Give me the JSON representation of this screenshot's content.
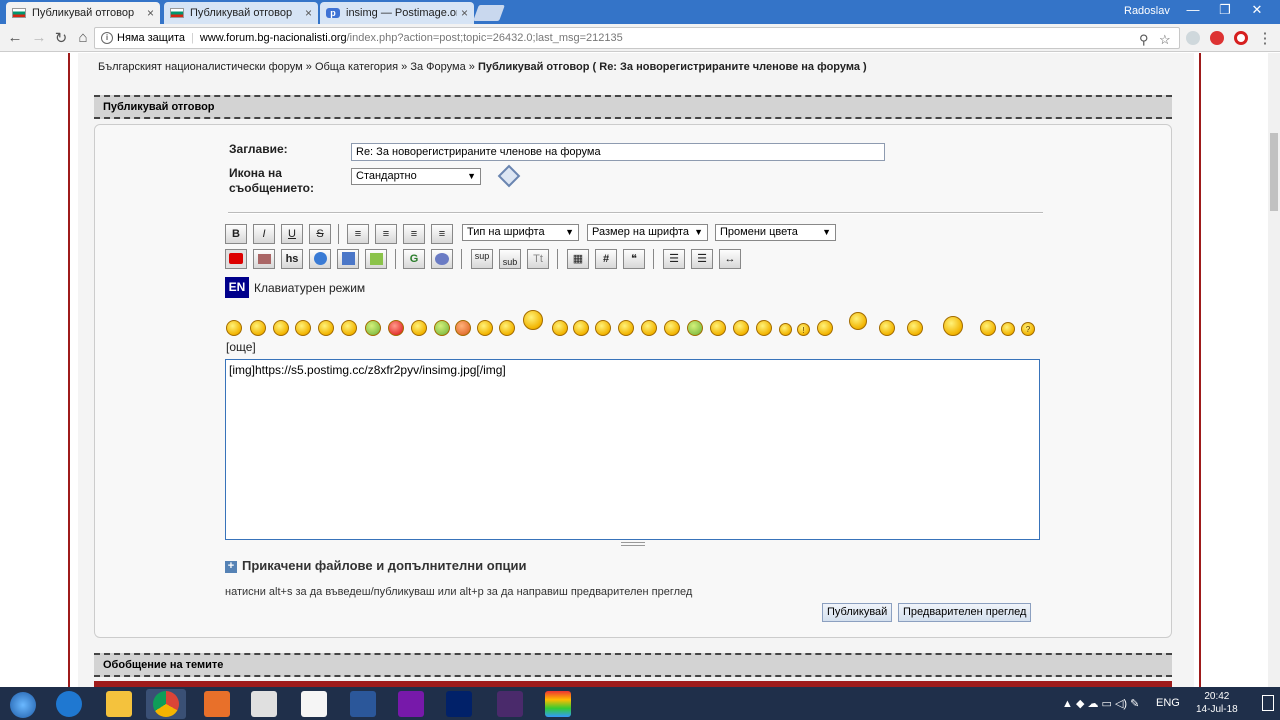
{
  "browser": {
    "tabs": [
      {
        "label": "Публикувай отговор",
        "icon": "bulgarian-flag-icon",
        "active": true
      },
      {
        "label": "Публикувай отговор",
        "icon": "bulgarian-flag-icon",
        "active": false
      },
      {
        "label": "insimg — Postimage.org",
        "icon": "postimage-icon",
        "active": false
      }
    ],
    "close_glyph": "×",
    "user": "Radoslav",
    "window_controls": {
      "minimize": "—",
      "maximize": "❐",
      "close": "✕"
    },
    "security_label": "Няма защита",
    "url_host": "www.forum.bg-nacionalisti.org",
    "url_path": "/index.php?action=post;topic=26432.0;last_msg=212135"
  },
  "forum": {
    "breadcrumb": {
      "c1": "Българският националистически форум",
      "sep": "»",
      "c2": "Обща категория",
      "c3": "За Форума",
      "c4": "Публикувай отговор",
      "topic": "( Re: За новорегистрираните членове на форума )"
    },
    "header": "Публикувай отговор",
    "subject_label": "Заглавие:",
    "subject_value": "Re: За новорегистрираните членове на форума",
    "icon_label_1": "Икона на",
    "icon_label_2": "съобщението:",
    "icon_select": "Стандартно",
    "font_face_select": "Тип на шрифта",
    "font_size_select": "Размер на шрифта",
    "color_select": "Промени цвета",
    "toolbar_row1": [
      "B",
      "I",
      "U",
      "S"
    ],
    "toolbar_row2": [
      "hs",
      "G",
      "sup",
      "sub",
      "Tt",
      "#"
    ],
    "kbd_badge": "EN",
    "kbd_label": "Клавиатурен режим",
    "more_link": "[още]",
    "message": "[img]https://s5.postimg.cc/z8xfr2pyv/insimg.jpg[/img]",
    "attach_label": "Прикачени файлове и допълнителни опции",
    "hint": "натисни alt+s за да въведеш/публикуваш или alt+p за да направиш предварителен преглед",
    "post_button": "Публикувай",
    "preview_button": "Предварителен преглед",
    "summary_header": "Обобщение на темите"
  },
  "taskbar": {
    "lang": "ENG",
    "time": "20:42",
    "date": "14-Jul-18"
  }
}
